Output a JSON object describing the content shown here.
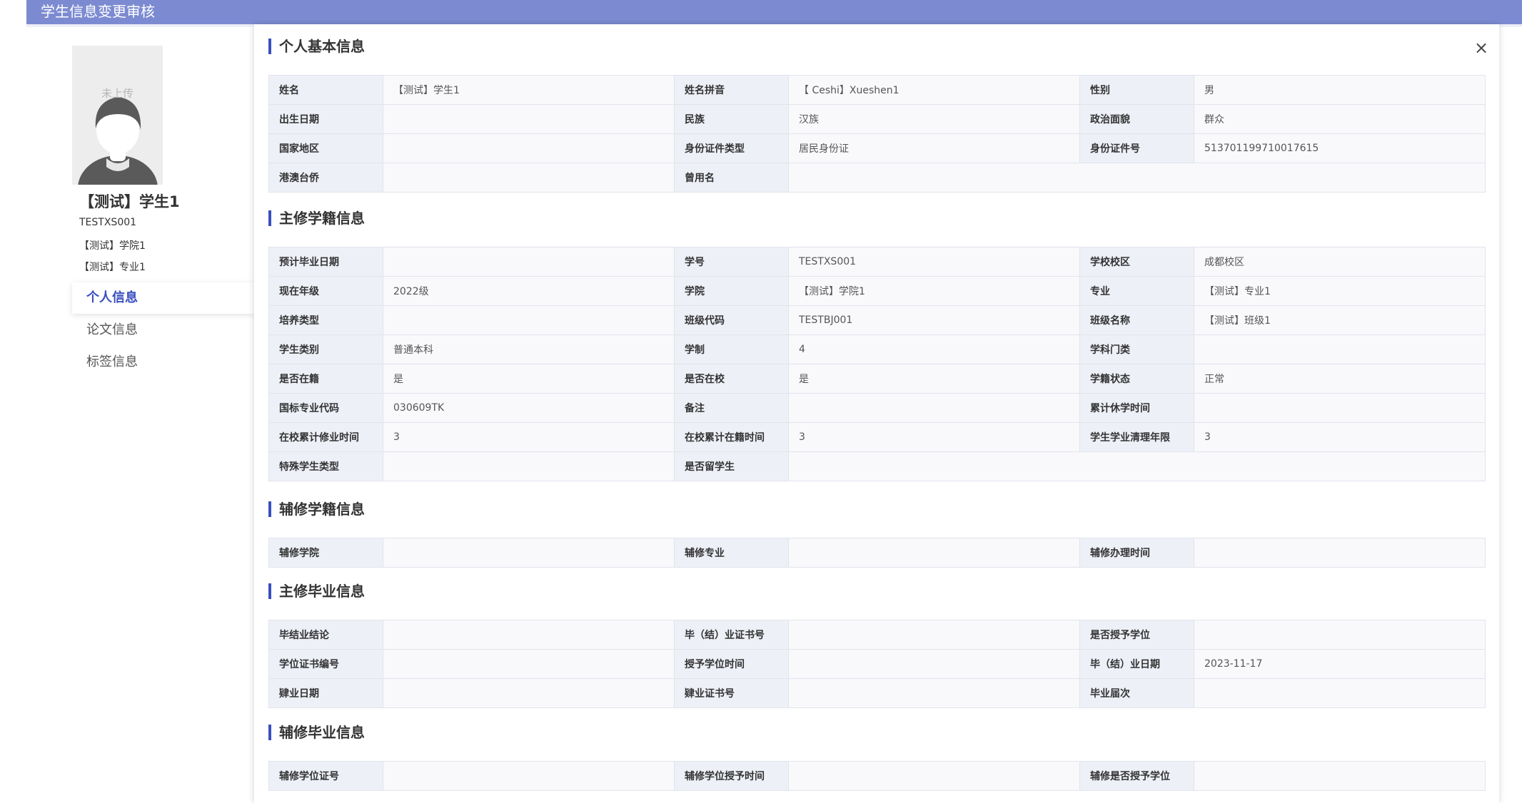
{
  "header": {
    "title": "学生信息变更审核"
  },
  "sidebar": {
    "avatar_placeholder": "未上传",
    "student_name": "【测试】学生1",
    "student_id": "TESTXS001",
    "college": "【测试】学院1",
    "major": "【测试】专业1",
    "nav": [
      "个人信息",
      "论文信息",
      "标签信息"
    ]
  },
  "panel": {
    "close": "×"
  },
  "sections": [
    {
      "title": "个人基本信息",
      "rows": [
        [
          {
            "k": "姓名",
            "v": "【测试】学生1"
          },
          {
            "k": "姓名拼音",
            "v": "【 Ceshi】Xueshen1"
          },
          {
            "k": "性别",
            "v": "男"
          }
        ],
        [
          {
            "k": "出生日期",
            "v": ""
          },
          {
            "k": "民族",
            "v": "汉族"
          },
          {
            "k": "政治面貌",
            "v": "群众"
          }
        ],
        [
          {
            "k": "国家地区",
            "v": ""
          },
          {
            "k": "身份证件类型",
            "v": "居民身份证"
          },
          {
            "k": "身份证件号",
            "v": "513701199710017615"
          }
        ],
        [
          {
            "k": "港澳台侨",
            "v": ""
          },
          {
            "k": "曾用名",
            "v": ""
          }
        ]
      ]
    },
    {
      "title": "主修学籍信息",
      "rows": [
        [
          {
            "k": "预计毕业日期",
            "v": ""
          },
          {
            "k": "学号",
            "v": "TESTXS001"
          },
          {
            "k": "学校校区",
            "v": "成都校区"
          }
        ],
        [
          {
            "k": "现在年级",
            "v": "2022级"
          },
          {
            "k": "学院",
            "v": "【测试】学院1"
          },
          {
            "k": "专业",
            "v": "【测试】专业1"
          }
        ],
        [
          {
            "k": "培养类型",
            "v": ""
          },
          {
            "k": "班级代码",
            "v": "TESTBJ001"
          },
          {
            "k": "班级名称",
            "v": "【测试】班级1"
          }
        ],
        [
          {
            "k": "学生类别",
            "v": "普通本科"
          },
          {
            "k": "学制",
            "v": "4"
          },
          {
            "k": "学科门类",
            "v": ""
          }
        ],
        [
          {
            "k": "是否在籍",
            "v": "是"
          },
          {
            "k": "是否在校",
            "v": "是"
          },
          {
            "k": "学籍状态",
            "v": "正常"
          }
        ],
        [
          {
            "k": "国标专业代码",
            "v": "030609TK"
          },
          {
            "k": "备注",
            "v": ""
          },
          {
            "k": "累计休学时间",
            "v": ""
          }
        ],
        [
          {
            "k": "在校累计修业时间",
            "v": "3"
          },
          {
            "k": "在校累计在籍时间",
            "v": "3"
          },
          {
            "k": "学生学业清理年限",
            "v": "3"
          }
        ],
        [
          {
            "k": "特殊学生类型",
            "v": ""
          },
          {
            "k": "是否留学生",
            "v": ""
          }
        ]
      ]
    },
    {
      "title": "辅修学籍信息",
      "rows": [
        [
          {
            "k": "辅修学院",
            "v": ""
          },
          {
            "k": "辅修专业",
            "v": ""
          },
          {
            "k": "辅修办理时间",
            "v": ""
          }
        ]
      ]
    },
    {
      "title": "主修毕业信息",
      "rows": [
        [
          {
            "k": "毕结业结论",
            "v": ""
          },
          {
            "k": "毕（结）业证书号",
            "v": ""
          },
          {
            "k": "是否授予学位",
            "v": ""
          }
        ],
        [
          {
            "k": "学位证书编号",
            "v": ""
          },
          {
            "k": "授予学位时间",
            "v": ""
          },
          {
            "k": "毕（结）业日期",
            "v": "2023-11-17"
          }
        ],
        [
          {
            "k": "肄业日期",
            "v": ""
          },
          {
            "k": "肄业证书号",
            "v": ""
          },
          {
            "k": "毕业届次",
            "v": ""
          }
        ]
      ]
    },
    {
      "title": "辅修毕业信息",
      "rows": [
        [
          {
            "k": "辅修学位证号",
            "v": ""
          },
          {
            "k": "辅修学位授予时间",
            "v": ""
          },
          {
            "k": "辅修是否授予学位",
            "v": ""
          }
        ]
      ]
    }
  ]
}
